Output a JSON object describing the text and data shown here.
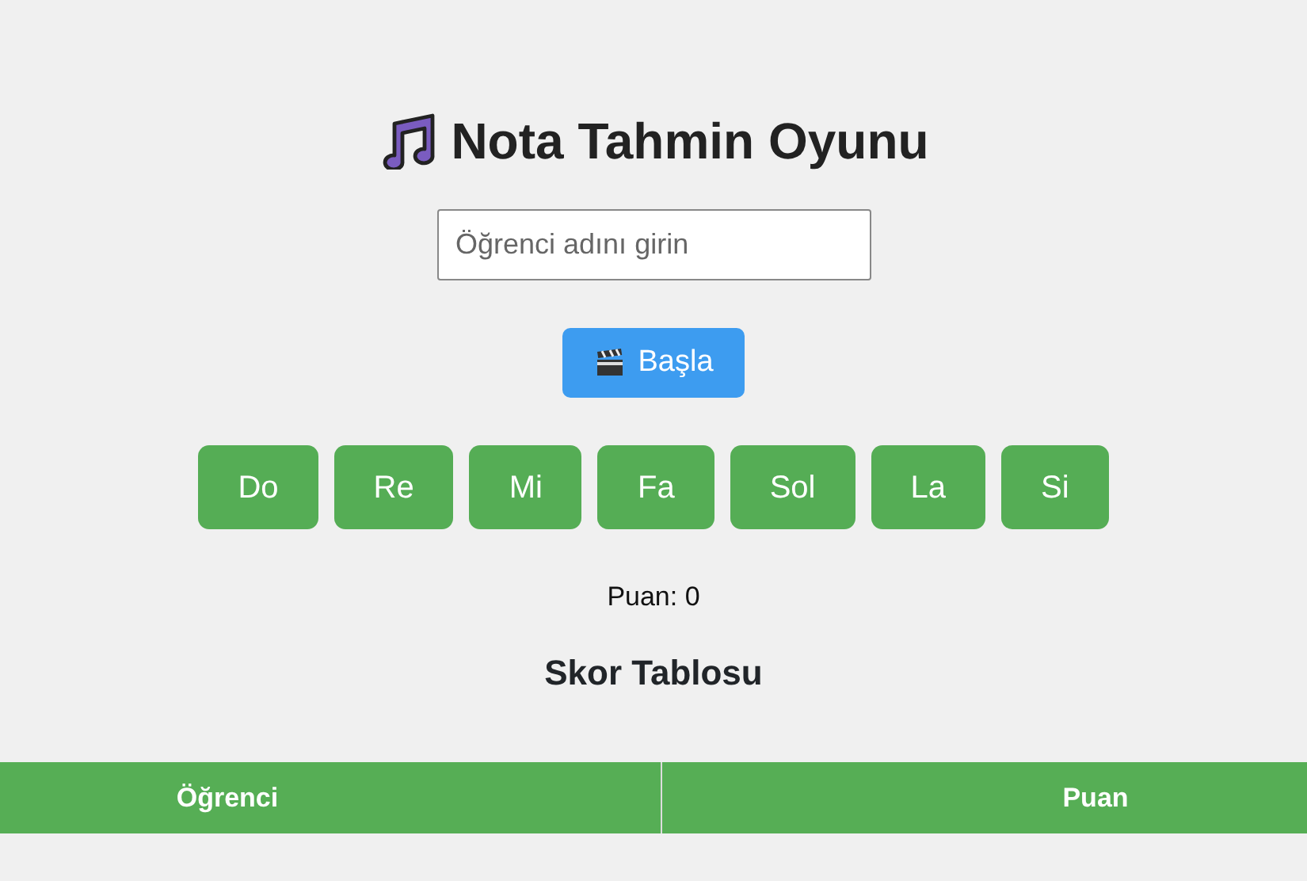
{
  "title": "Nota Tahmin Oyunu",
  "name_field": {
    "placeholder": "Öğrenci adını girin"
  },
  "start_button": "Başla",
  "notes": [
    "Do",
    "Re",
    "Mi",
    "Fa",
    "Sol",
    "La",
    "Si"
  ],
  "score": "Puan: 0",
  "scoreboard": {
    "title": "Skor Tablosu",
    "columns": [
      "Öğrenci",
      "Puan"
    ]
  }
}
